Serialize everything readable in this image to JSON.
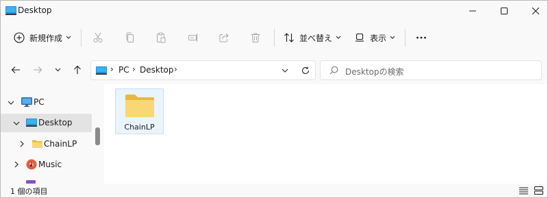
{
  "window": {
    "title": "Desktop",
    "colors": {
      "accent": "#0078d4",
      "folder": "#f8d775",
      "selected": "#e3e3e3"
    }
  },
  "commandbar": {
    "new_label": "新規作成",
    "sort_label": "並べ替え",
    "view_label": "表示",
    "icons": [
      "plus-circle-icon",
      "cut-icon",
      "copy-icon",
      "paste-icon",
      "rename-icon",
      "share-icon",
      "delete-icon",
      "sort-icon",
      "view-icon",
      "more-icon"
    ]
  },
  "address": {
    "crumbs": [
      "PC",
      "Desktop"
    ],
    "search_placeholder": "Desktopの検索"
  },
  "navpane": {
    "items": [
      {
        "label": "PC",
        "icon": "monitor-icon",
        "expanded": true
      },
      {
        "label": "Desktop",
        "icon": "desktop-icon",
        "expanded": true,
        "selected": true
      },
      {
        "label": "ChainLP",
        "icon": "folder-icon",
        "expanded": false
      },
      {
        "label": "Music",
        "icon": "music-icon",
        "expanded": false
      }
    ]
  },
  "content": {
    "items": [
      {
        "label": "ChainLP",
        "icon": "folder-icon"
      }
    ]
  },
  "status": {
    "text": "1 個の項目"
  }
}
